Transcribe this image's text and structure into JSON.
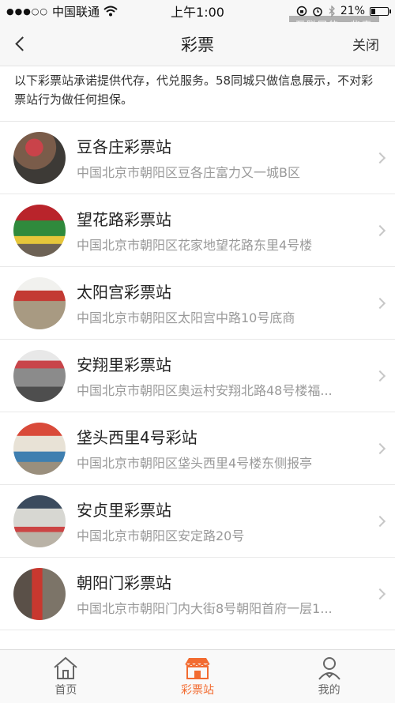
{
  "status_bar": {
    "signal_dots": "●●●○○",
    "carrier": "中国联通",
    "time": "上午1:00",
    "battery_percent": "21%",
    "battery_level": 0.21
  },
  "watermark": "互联网的一些事",
  "nav": {
    "title": "彩票",
    "close_label": "关闭"
  },
  "notice": "以下彩票站承诺提供代存，代兑服务。58同城只做信息展示，不对彩票站行为做任何担保。",
  "stations": [
    {
      "name": "豆各庄彩票站",
      "address": "中国北京市朝阳区豆各庄富力又一城B区"
    },
    {
      "name": "望花路彩票站",
      "address": "中国北京市朝阳区花家地望花路东里4号楼"
    },
    {
      "name": "太阳宫彩票站",
      "address": "中国北京市朝阳区太阳宫中路10号底商"
    },
    {
      "name": "安翔里彩票站",
      "address": "中国北京市朝阳区奥运村安翔北路48号楼福..."
    },
    {
      "name": "垡头西里4号彩站",
      "address": "中国北京市朝阳区垡头西里4号楼东侧报亭"
    },
    {
      "name": "安贞里彩票站",
      "address": "中国北京市朝阳区安定路20号"
    },
    {
      "name": "朝阳门彩票站",
      "address": "中国北京市朝阳门内大街8号朝阳首府一层1..."
    }
  ],
  "tabs": [
    {
      "label": "首页",
      "icon": "home-icon"
    },
    {
      "label": "彩票站",
      "icon": "store-icon"
    },
    {
      "label": "我的",
      "icon": "user-icon"
    }
  ],
  "colors": {
    "accent": "#f26b30",
    "divider": "#e9e9e9",
    "subtext": "#999999"
  }
}
